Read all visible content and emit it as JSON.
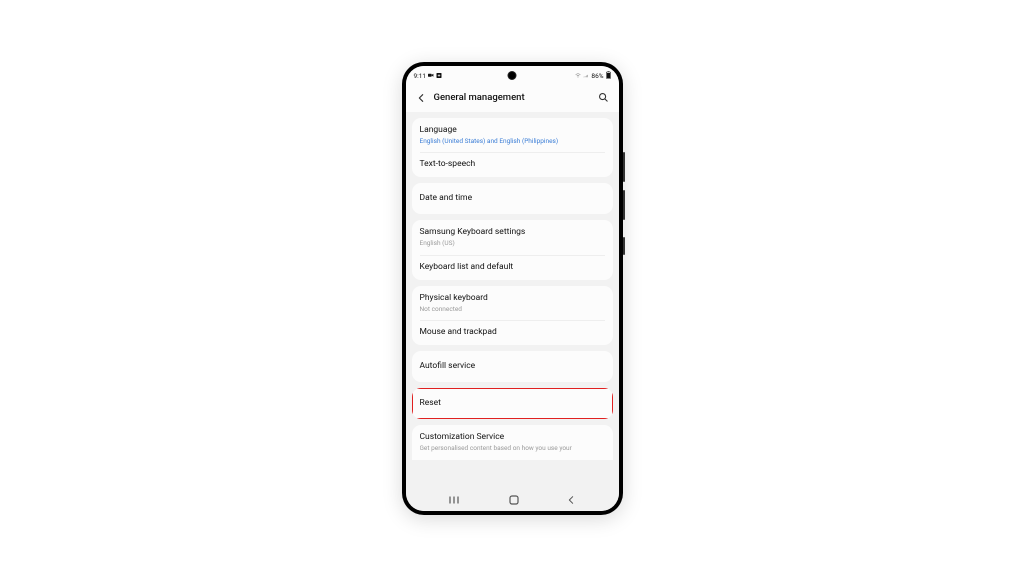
{
  "status": {
    "time": "9:11",
    "battery": "86%"
  },
  "header": {
    "title": "General management"
  },
  "groups": [
    {
      "items": [
        {
          "title": "Language",
          "sub": "English (United States) and English (Philippines)",
          "subAccent": true
        },
        {
          "title": "Text-to-speech"
        }
      ]
    },
    {
      "items": [
        {
          "title": "Date and time"
        }
      ]
    },
    {
      "items": [
        {
          "title": "Samsung Keyboard settings",
          "sub": "English (US)"
        },
        {
          "title": "Keyboard list and default"
        }
      ]
    },
    {
      "items": [
        {
          "title": "Physical keyboard",
          "sub": "Not connected"
        },
        {
          "title": "Mouse and trackpad"
        }
      ]
    },
    {
      "items": [
        {
          "title": "Autofill service"
        }
      ]
    },
    {
      "highlight": true,
      "items": [
        {
          "title": "Reset"
        }
      ]
    },
    {
      "cut": true,
      "items": [
        {
          "title": "Customization Service",
          "sub": "Get personalised content based on how you use your"
        }
      ]
    }
  ]
}
